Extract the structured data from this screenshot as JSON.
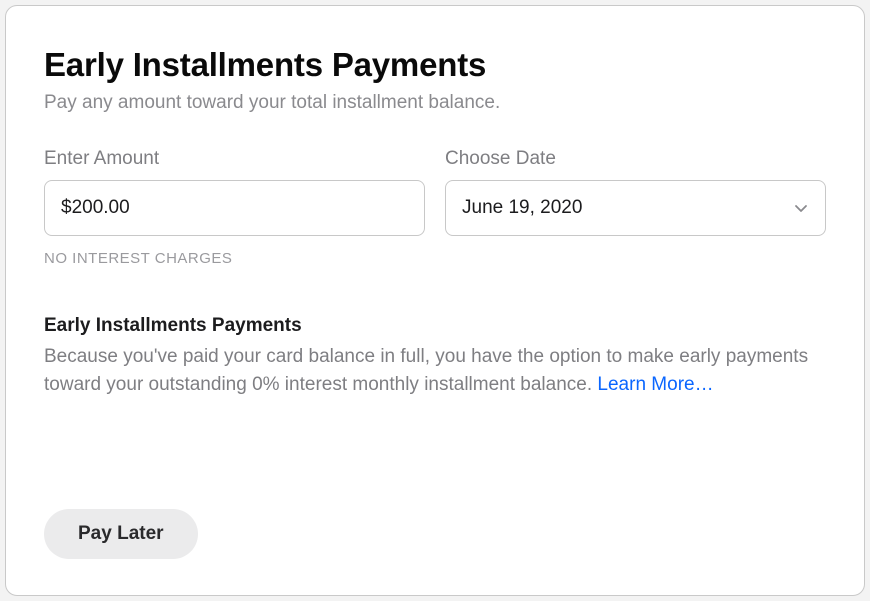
{
  "header": {
    "title": "Early Installments Payments",
    "subtitle": "Pay any amount toward your total installment balance."
  },
  "form": {
    "amount": {
      "label": "Enter Amount",
      "value": "$200.00"
    },
    "date": {
      "label": "Choose Date",
      "value": "June 19, 2020"
    },
    "interest_note": "NO INTEREST CHARGES"
  },
  "info": {
    "title": "Early Installments Payments",
    "body": "Because you've paid your card balance in full, you have the option to make early payments toward your outstanding 0% interest monthly installment balance. ",
    "learn_more": "Learn More…"
  },
  "actions": {
    "pay_later": "Pay Later"
  }
}
